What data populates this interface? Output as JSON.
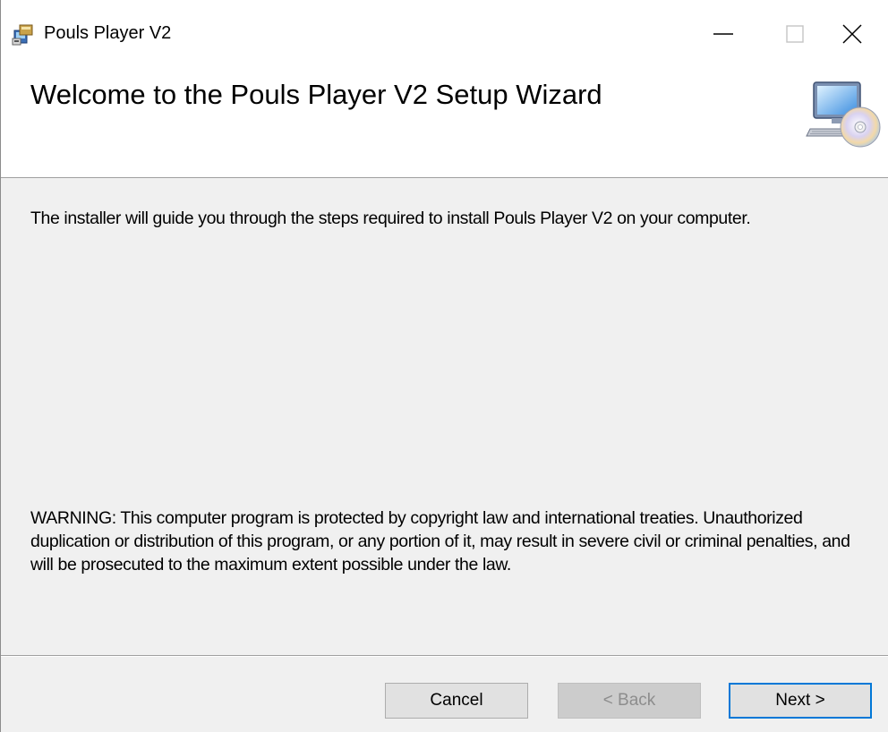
{
  "window": {
    "title": "Pouls Player V2",
    "icons": {
      "app": "installer-app-icon",
      "minimize": "minimize-icon",
      "maximize": "maximize-icon",
      "close": "close-icon"
    }
  },
  "header": {
    "title": "Welcome to the Pouls Player V2 Setup Wizard",
    "icon": "computer-cd-icon"
  },
  "body": {
    "intro": "The installer will guide you through the steps required to install Pouls Player V2 on your computer.",
    "warning": "WARNING: This computer program is protected by copyright law and international treaties. Unauthorized duplication or distribution of this program, or any portion of it, may result in severe civil or criminal penalties, and will be prosecuted to the maximum extent possible under the law."
  },
  "buttons": {
    "cancel": "Cancel",
    "back": "< Back",
    "next": "Next >"
  },
  "colors": {
    "focus_border": "#0078d7",
    "window_bg": "#f0f0f0",
    "header_bg": "#ffffff"
  }
}
